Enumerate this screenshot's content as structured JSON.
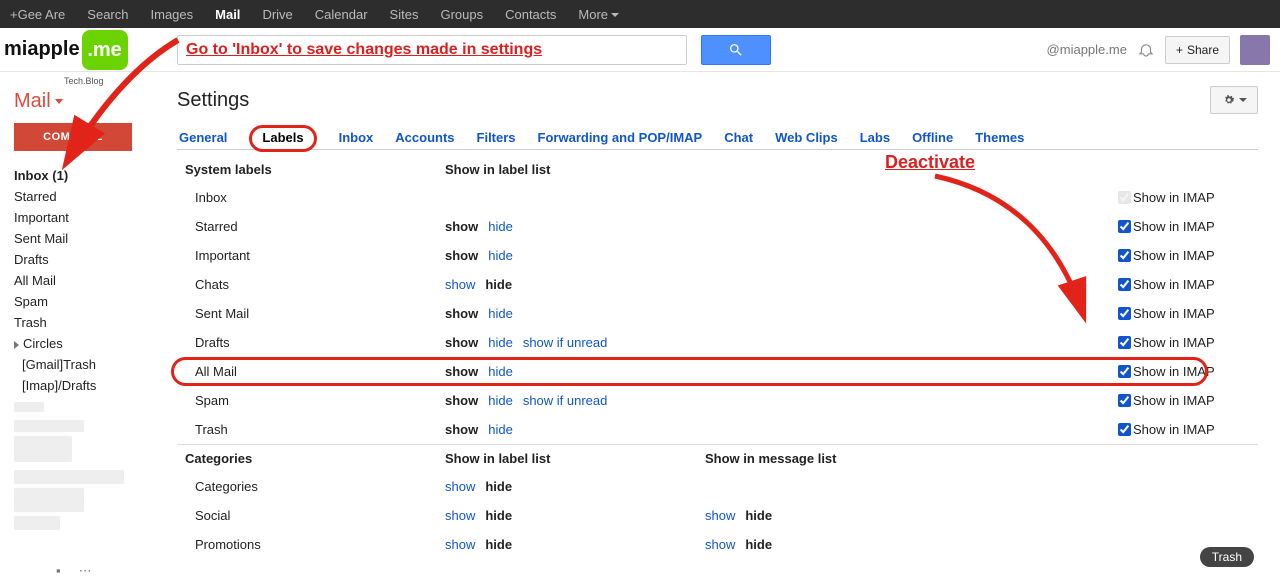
{
  "topbar": {
    "items": [
      "+Gee Are",
      "Search",
      "Images",
      "Mail",
      "Drive",
      "Calendar",
      "Sites",
      "Groups",
      "Contacts",
      "More"
    ],
    "active_index": 3
  },
  "logo": {
    "left": "miapple",
    "right": ".me",
    "sub": "Tech.Blog"
  },
  "search": {
    "annotation": "Go to 'Inbox' to save changes made in settings"
  },
  "user": {
    "email": "@miapple.me",
    "share": "Share"
  },
  "sidebar": {
    "mail_label": "Mail",
    "compose": "COMPOSE",
    "items": [
      {
        "label": "Inbox (1)",
        "bold": true
      },
      {
        "label": "Starred"
      },
      {
        "label": "Important"
      },
      {
        "label": "Sent Mail"
      },
      {
        "label": "Drafts"
      },
      {
        "label": "All Mail"
      },
      {
        "label": "Spam"
      },
      {
        "label": "Trash"
      },
      {
        "label": "Circles",
        "expander": true
      },
      {
        "label": "[Gmail]Trash",
        "sub": true
      },
      {
        "label": "[Imap]/Drafts",
        "sub": true
      }
    ]
  },
  "page": {
    "title": "Settings"
  },
  "tabs": [
    "General",
    "Labels",
    "Inbox",
    "Accounts",
    "Filters",
    "Forwarding and POP/IMAP",
    "Chat",
    "Web Clips",
    "Labs",
    "Offline",
    "Themes"
  ],
  "active_tab_index": 1,
  "headers": {
    "system": "System labels",
    "showlist": "Show in label list",
    "categories": "Categories",
    "msglist": "Show in message list"
  },
  "words": {
    "show": "show",
    "hide": "hide",
    "show_if_unread": "show if unread",
    "show_imap": "Show in IMAP"
  },
  "sys_rows": [
    {
      "name": "Inbox",
      "show": "",
      "hide": "",
      "extra": "",
      "imap_checked": true,
      "imap_disabled": true
    },
    {
      "name": "Starred",
      "show": "bold",
      "hide": "link",
      "extra": "",
      "imap_checked": true
    },
    {
      "name": "Important",
      "show": "bold",
      "hide": "link",
      "extra": "",
      "imap_checked": true
    },
    {
      "name": "Chats",
      "show": "link",
      "hide": "bold",
      "extra": "",
      "imap_checked": true
    },
    {
      "name": "Sent Mail",
      "show": "bold",
      "hide": "link",
      "extra": "",
      "imap_checked": true
    },
    {
      "name": "Drafts",
      "show": "bold",
      "hide": "link",
      "extra": "unread",
      "imap_checked": true
    },
    {
      "name": "All Mail",
      "show": "bold",
      "hide": "link",
      "extra": "",
      "imap_checked": true,
      "circled": true
    },
    {
      "name": "Spam",
      "show": "bold",
      "hide": "link",
      "extra": "unread",
      "imap_checked": true
    },
    {
      "name": "Trash",
      "show": "bold",
      "hide": "link",
      "extra": "",
      "imap_checked": true
    }
  ],
  "cat_rows": [
    {
      "name": "Categories",
      "show": "link",
      "hide": "bold",
      "msg_show": "",
      "msg_hide": ""
    },
    {
      "name": "Social",
      "show": "link",
      "hide": "bold",
      "msg_show": "link",
      "msg_hide": "bold"
    },
    {
      "name": "Promotions",
      "show": "link",
      "hide": "bold",
      "msg_show": "link",
      "msg_hide": "bold"
    }
  ],
  "annotations": {
    "deactivate": "Deactivate"
  },
  "trash_chip": "Trash"
}
